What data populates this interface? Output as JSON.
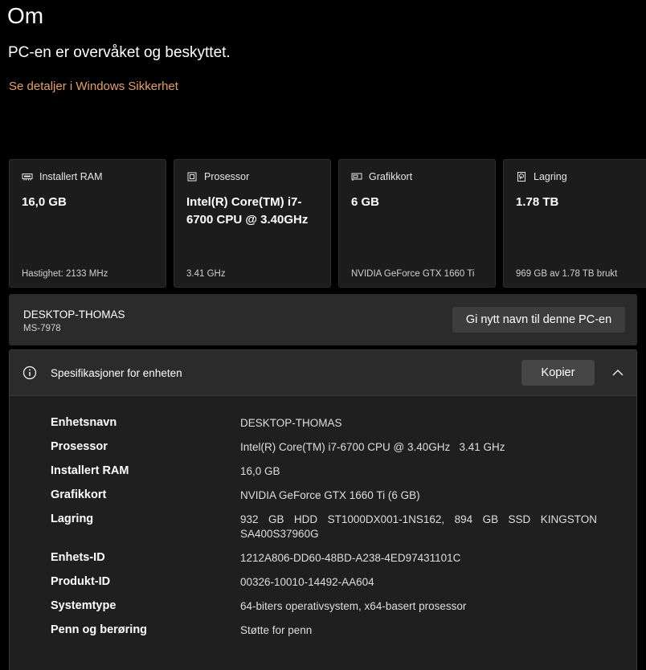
{
  "page": {
    "title": "Om",
    "status": "PC-en er overvåket og beskyttet.",
    "security_link": "Se detaljer i Windows Sikkerhet"
  },
  "cards": [
    {
      "icon": "ram-icon",
      "label": "Installert RAM",
      "value": "16,0 GB",
      "footer": "Hastighet: 2133 MHz"
    },
    {
      "icon": "processor-icon",
      "label": "Prosessor",
      "value": "Intel(R) Core(TM) i7-6700 CPU @ 3.40GHz",
      "footer": "3.41 GHz"
    },
    {
      "icon": "graphics-card-icon",
      "label": "Grafikkort",
      "value": "6 GB",
      "footer": "NVIDIA GeForce GTX 1660 Ti"
    },
    {
      "icon": "storage-icon",
      "label": "Lagring",
      "value": "1.78 TB",
      "footer": "969 GB av 1.78 TB brukt"
    }
  ],
  "device": {
    "name": "DESKTOP-THOMAS",
    "model": "MS-7978",
    "rename_label": "Gi nytt navn til denne PC-en"
  },
  "specs": {
    "title": "Spesifikasjoner for enheten",
    "copy_label": "Kopier",
    "rows": [
      {
        "label": "Enhetsnavn",
        "value": "DESKTOP-THOMAS"
      },
      {
        "label": "Prosessor",
        "value": "Intel(R) Core(TM) i7-6700 CPU @ 3.40GHz   3.41 GHz"
      },
      {
        "label": "Installert RAM",
        "value": "16,0 GB"
      },
      {
        "label": "Grafikkort",
        "value": "NVIDIA GeForce GTX 1660 Ti (6 GB)"
      },
      {
        "label": "Lagring",
        "value": "932 GB HDD ST1000DX001-1NS162, 894 GB SSD KINGSTON SA400S37960G"
      },
      {
        "label": "Enhets-ID",
        "value": "1212A806-DD60-48BD-A238-4ED97431101C"
      },
      {
        "label": "Produkt-ID",
        "value": "00326-10010-14492-AA604"
      },
      {
        "label": "Systemtype",
        "value": "64-biters operativsystem, x64-basert prosessor"
      },
      {
        "label": "Penn og berøring",
        "value": "Støtte for penn"
      }
    ]
  },
  "colors": {
    "background": "#000000",
    "card": "#1c1c1c",
    "link": "#e8a15c",
    "button": "#3d3d3d"
  }
}
